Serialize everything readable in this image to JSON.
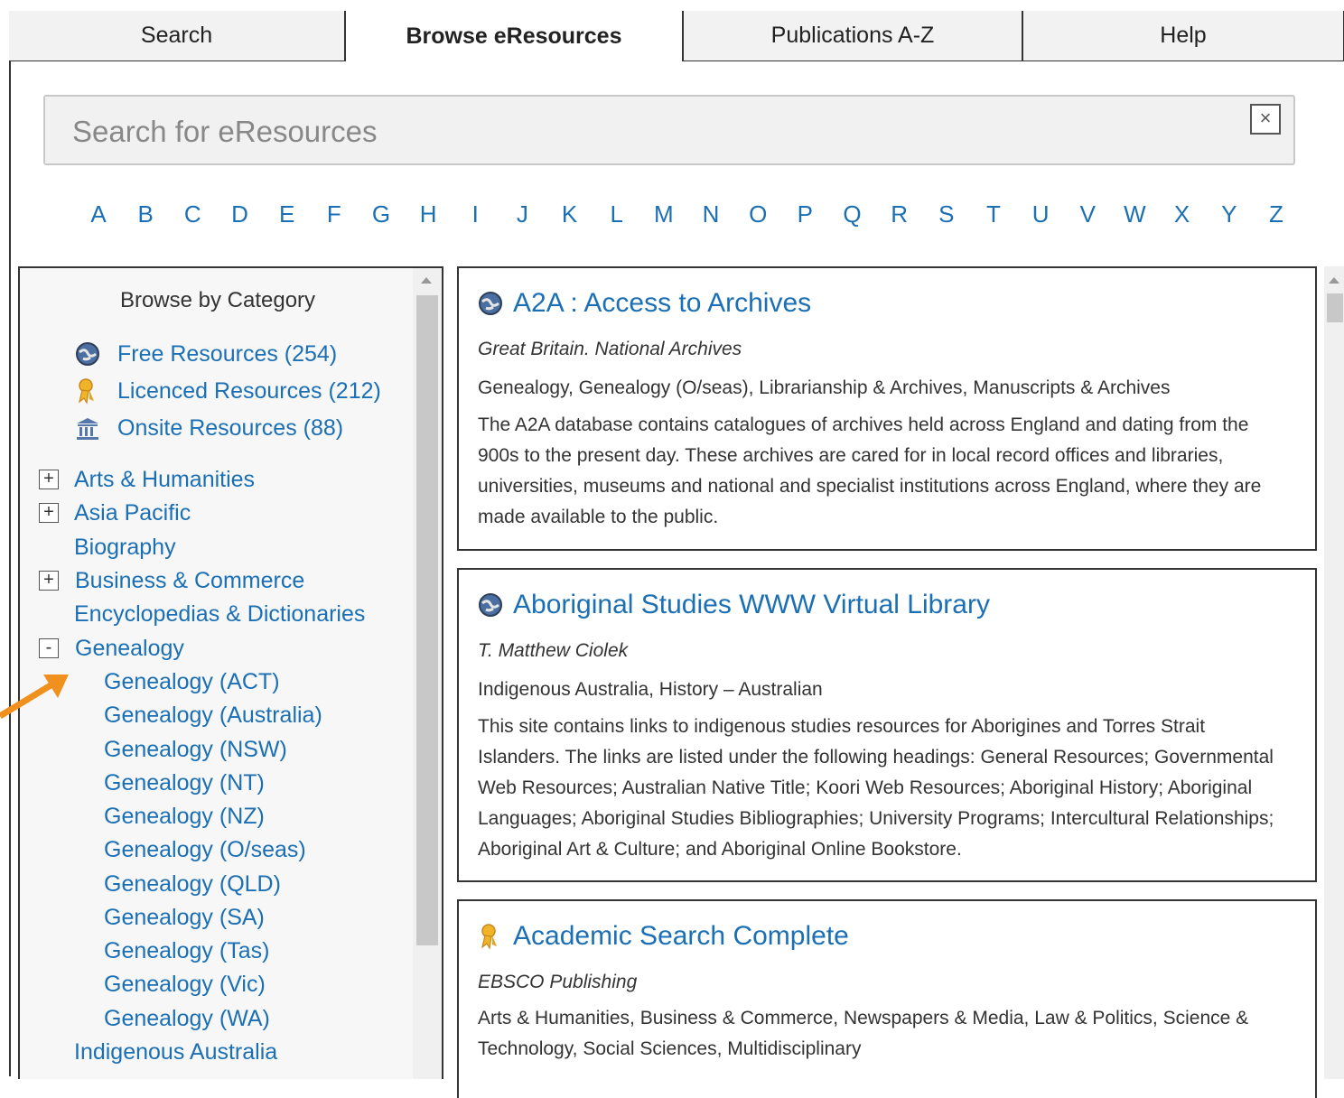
{
  "tabs": [
    {
      "label": "Search"
    },
    {
      "label": "Browse eResources"
    },
    {
      "label": "Publications A-Z"
    },
    {
      "label": "Help"
    }
  ],
  "search": {
    "placeholder": "Search for eResources",
    "clear": "×"
  },
  "alphabet": [
    "A",
    "B",
    "C",
    "D",
    "E",
    "F",
    "G",
    "H",
    "I",
    "J",
    "K",
    "L",
    "M",
    "N",
    "O",
    "P",
    "Q",
    "R",
    "S",
    "T",
    "U",
    "V",
    "W",
    "X",
    "Y",
    "Z"
  ],
  "sidebar": {
    "title": "Browse by Category",
    "resources": [
      {
        "label": "Free Resources (254)",
        "icon": "globe-icon"
      },
      {
        "label": "Licenced Resources (212)",
        "icon": "ribbon-icon"
      },
      {
        "label": "Onsite Resources (88)",
        "icon": "building-icon"
      }
    ],
    "categories": [
      {
        "label": "Arts & Humanities",
        "toggle": "+"
      },
      {
        "label": "Asia Pacific",
        "toggle": "+"
      },
      {
        "label": "Biography",
        "toggle": ""
      },
      {
        "label": "Business & Commerce",
        "toggle": "+"
      },
      {
        "label": "Encyclopedias & Dictionaries",
        "toggle": ""
      },
      {
        "label": "Genealogy",
        "toggle": "-"
      }
    ],
    "subcategories": [
      "Genealogy (ACT)",
      "Genealogy (Australia)",
      "Genealogy (NSW)",
      "Genealogy (NT)",
      "Genealogy (NZ)",
      "Genealogy (O/seas)",
      "Genealogy (QLD)",
      "Genealogy (SA)",
      "Genealogy (Tas)",
      "Genealogy (Vic)",
      "Genealogy (WA)"
    ],
    "after": "Indigenous Australia"
  },
  "results": [
    {
      "title": "A2A : Access to Archives",
      "icon": "globe-icon",
      "publisher": "Great Britain. National Archives",
      "subjects": "Genealogy, Genealogy (O/seas), Librarianship & Archives, Manuscripts & Archives",
      "description": "The A2A database contains catalogues of archives held across England and dating from the 900s to the present day. These archives are cared for in local record offices and libraries, universities, museums and national and specialist institutions across England, where they are made available to the public."
    },
    {
      "title": "Aboriginal Studies WWW Virtual Library",
      "icon": "globe-icon",
      "publisher": "T. Matthew Ciolek",
      "subjects": "Indigenous Australia, History – Australian",
      "description": "This site contains links to indigenous studies resources for Aborigines and Torres Strait Islanders. The links are listed under the following headings: General Resources; Governmental Web Resources; Australian Native Title; Koori Web Resources; Aboriginal History; Aboriginal Languages; Aboriginal Studies Bibliographies; University Programs; Intercultural Relationships; Aboriginal Art & Culture; and Aboriginal Online Bookstore."
    },
    {
      "title": "Academic Search Complete",
      "icon": "ribbon-icon",
      "publisher": "EBSCO Publishing",
      "subjects": "Arts & Humanities, Business & Commerce, Newspapers & Media, Law & Politics, Science & Technology, Social Sciences, Multidisciplinary",
      "description": ""
    }
  ],
  "colors": {
    "link": "#1b6fb4",
    "arrow": "#f0901e"
  }
}
